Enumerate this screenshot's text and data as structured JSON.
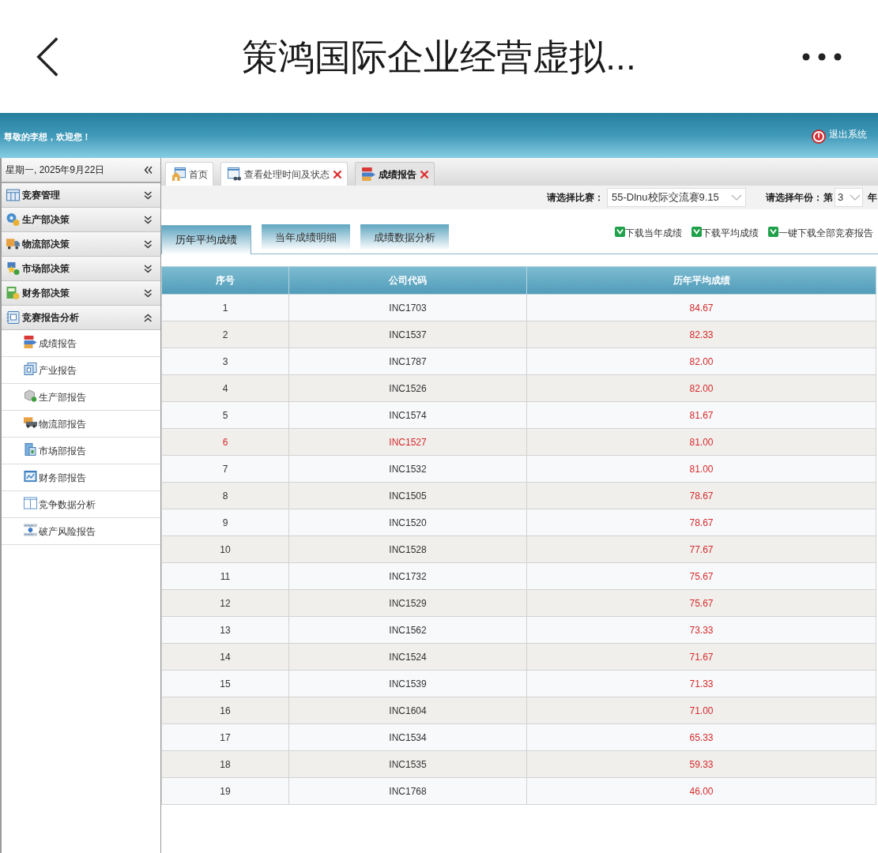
{
  "app_bar": {
    "title": "策鸿国际企业经营虚拟..."
  },
  "header": {
    "greeting": "尊敬的李想，欢迎您！",
    "logout": "退出系统"
  },
  "sidebar": {
    "date": "星期一, 2025年9月22日",
    "menus": [
      {
        "label": "竞赛管理",
        "expanded": false
      },
      {
        "label": "生产部决策",
        "expanded": false
      },
      {
        "label": "物流部决策",
        "expanded": false
      },
      {
        "label": "市场部决策",
        "expanded": false
      },
      {
        "label": "财务部决策",
        "expanded": false
      },
      {
        "label": "竞赛报告分析",
        "expanded": true,
        "children": [
          {
            "label": "成绩报告"
          },
          {
            "label": "产业报告"
          },
          {
            "label": "生产部报告"
          },
          {
            "label": "物流部报告"
          },
          {
            "label": "市场部报告"
          },
          {
            "label": "财务部报告"
          },
          {
            "label": "竞争数据分析"
          },
          {
            "label": "破产风险报告"
          }
        ]
      }
    ]
  },
  "tabs": [
    {
      "label": "首页",
      "closable": false,
      "selected": false
    },
    {
      "label": "查看处理时间及状态",
      "closable": true,
      "selected": false
    },
    {
      "label": "成绩报告",
      "closable": true,
      "selected": true
    }
  ],
  "filters": {
    "match_label": "请选择比赛：",
    "match_value": "55-Dlnu校际交流赛9.15",
    "year_label": "请选择年份：",
    "year_prefix": "第",
    "year_value": "3",
    "year_suffix": "年"
  },
  "report_tabs": [
    {
      "label": "历年平均成绩",
      "selected": true
    },
    {
      "label": "当年成绩明细",
      "selected": false
    },
    {
      "label": "成绩数据分析",
      "selected": false
    }
  ],
  "downloads": [
    "下载当年成绩",
    "下载平均成绩",
    "一键下载全部竞赛报告"
  ],
  "table": {
    "columns": [
      "序号",
      "公司代码",
      "历年平均成绩"
    ],
    "rows": [
      {
        "cells": [
          "1",
          "INC1703",
          "84.67"
        ],
        "highlighted": false
      },
      {
        "cells": [
          "2",
          "INC1537",
          "82.33"
        ],
        "highlighted": false
      },
      {
        "cells": [
          "3",
          "INC1787",
          "82.00"
        ],
        "highlighted": false
      },
      {
        "cells": [
          "4",
          "INC1526",
          "82.00"
        ],
        "highlighted": false
      },
      {
        "cells": [
          "5",
          "INC1574",
          "81.67"
        ],
        "highlighted": false
      },
      {
        "cells": [
          "6",
          "INC1527",
          "81.00"
        ],
        "highlighted": true
      },
      {
        "cells": [
          "7",
          "INC1532",
          "81.00"
        ],
        "highlighted": false
      },
      {
        "cells": [
          "8",
          "INC1505",
          "78.67"
        ],
        "highlighted": false
      },
      {
        "cells": [
          "9",
          "INC1520",
          "78.67"
        ],
        "highlighted": false
      },
      {
        "cells": [
          "10",
          "INC1528",
          "77.67"
        ],
        "highlighted": false
      },
      {
        "cells": [
          "11",
          "INC1732",
          "75.67"
        ],
        "highlighted": false
      },
      {
        "cells": [
          "12",
          "INC1529",
          "75.67"
        ],
        "highlighted": false
      },
      {
        "cells": [
          "13",
          "INC1562",
          "73.33"
        ],
        "highlighted": false
      },
      {
        "cells": [
          "14",
          "INC1524",
          "71.67"
        ],
        "highlighted": false
      },
      {
        "cells": [
          "15",
          "INC1539",
          "71.33"
        ],
        "highlighted": false
      },
      {
        "cells": [
          "16",
          "INC1604",
          "71.00"
        ],
        "highlighted": false
      },
      {
        "cells": [
          "17",
          "INC1534",
          "65.33"
        ],
        "highlighted": false
      },
      {
        "cells": [
          "18",
          "INC1535",
          "59.33"
        ],
        "highlighted": false
      },
      {
        "cells": [
          "19",
          "INC1768",
          "46.00"
        ],
        "highlighted": false
      }
    ]
  }
}
